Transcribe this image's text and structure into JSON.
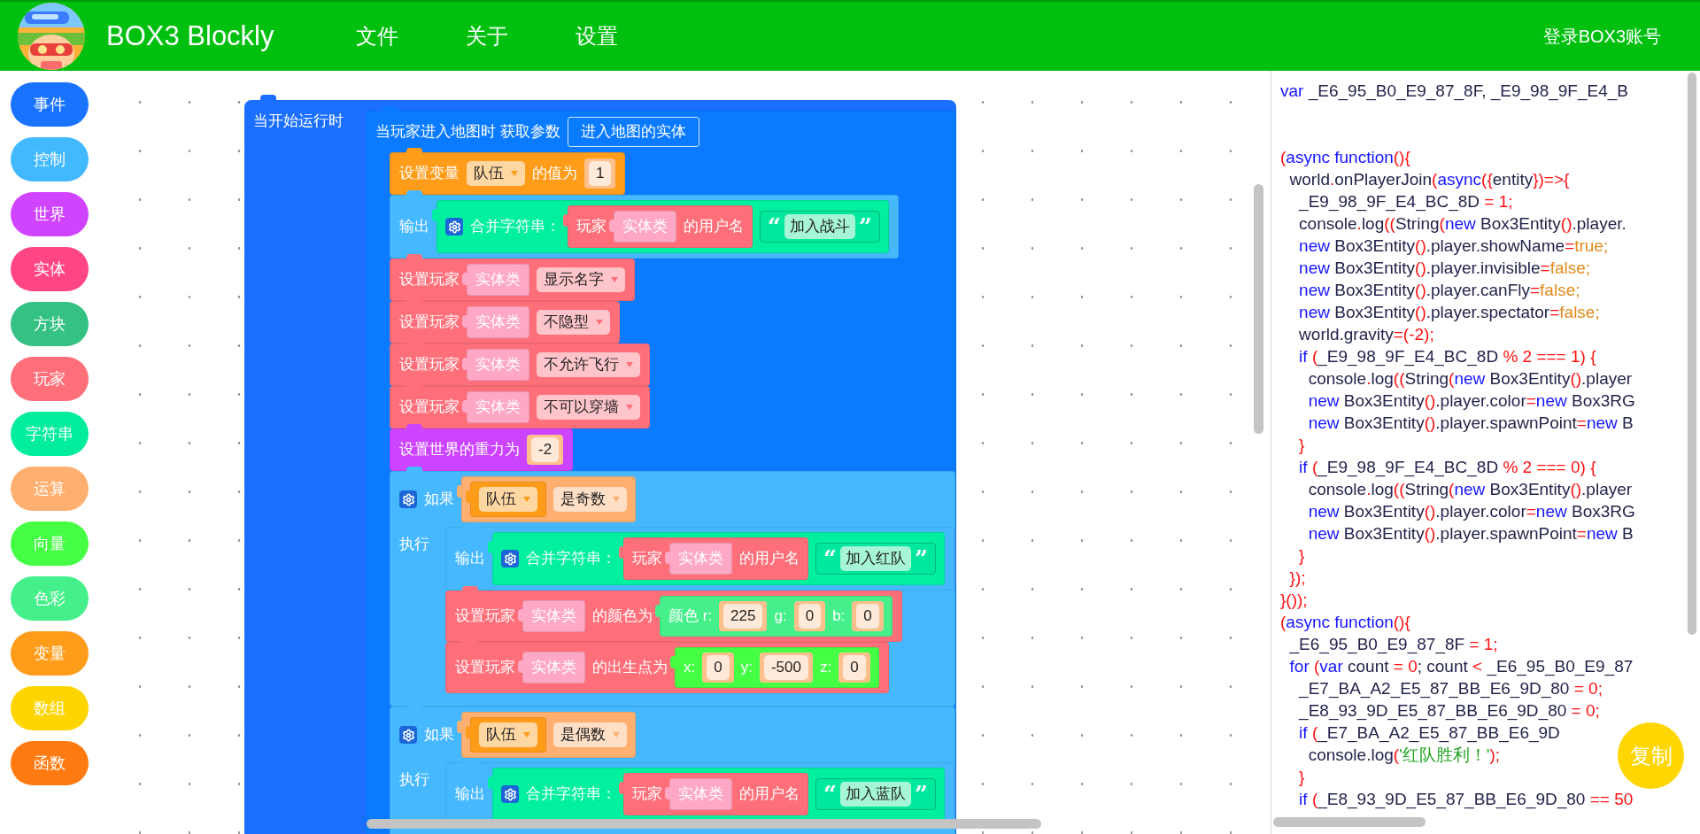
{
  "header": {
    "title": "BOX3 Blockly",
    "menu": [
      "文件",
      "关于",
      "设置"
    ],
    "login": "登录BOX3账号"
  },
  "categories": [
    {
      "label": "事件",
      "color": "#1a73ff"
    },
    {
      "label": "控制",
      "color": "#42b9ff"
    },
    {
      "label": "世界",
      "color": "#d044ff"
    },
    {
      "label": "实体",
      "color": "#ff4585"
    },
    {
      "label": "方块",
      "color": "#36c184"
    },
    {
      "label": "玩家",
      "color": "#ff6f7a"
    },
    {
      "label": "字符串",
      "color": "#00eda0"
    },
    {
      "label": "运算",
      "color": "#ffb070"
    },
    {
      "label": "向量",
      "color": "#44ff44"
    },
    {
      "label": "色彩",
      "color": "#45f08a"
    },
    {
      "label": "变量",
      "color": "#ff9c1a"
    },
    {
      "label": "数组",
      "color": "#ffd500"
    },
    {
      "label": "函数",
      "color": "#ff7a10"
    }
  ],
  "workspace": {
    "blocks": [
      {
        "kind": "hat",
        "color": "#1a6fff",
        "parts": [
          {
            "kind": "text",
            "text": "当开始运行时"
          }
        ],
        "branches": [
          {
            "body": [
              {
                "kind": "statement",
                "color": "#0a7bff",
                "parts": [
                  {
                    "kind": "text",
                    "text": "当玩家进入地图时 获取参数"
                  },
                  {
                    "kind": "param",
                    "text": "进入地图的实体"
                  }
                ],
                "branches": [
                  {
                    "body": [
                      {
                        "kind": "statement",
                        "color": "#ff9c1a",
                        "parts": [
                          {
                            "kind": "text",
                            "text": "设置变量"
                          },
                          {
                            "kind": "dropdown",
                            "text": "队伍"
                          },
                          {
                            "kind": "text",
                            "text": "的值为"
                          },
                          {
                            "kind": "number",
                            "text": "1"
                          }
                        ]
                      },
                      {
                        "kind": "statement",
                        "color": "#45b8ff",
                        "parts": [
                          {
                            "kind": "text",
                            "text": "输出"
                          },
                          {
                            "kind": "block",
                            "color": "#00f0a0",
                            "parts": [
                              {
                                "kind": "gear"
                              },
                              {
                                "kind": "text",
                                "text": "合并字符串："
                              },
                              {
                                "kind": "block",
                                "color": "#ff6f7a",
                                "parts": [
                                  {
                                    "kind": "text",
                                    "text": "玩家"
                                  },
                                  {
                                    "kind": "block",
                                    "color": "#ffa8c5",
                                    "parts": [
                                      {
                                        "kind": "text",
                                        "text": "实体类"
                                      }
                                    ]
                                  },
                                  {
                                    "kind": "text",
                                    "text": "的用户名"
                                  }
                                ]
                              },
                              {
                                "kind": "string",
                                "open": "“",
                                "text": "加入战斗",
                                "close": "”"
                              }
                            ]
                          }
                        ]
                      },
                      {
                        "kind": "statement",
                        "color": "#ff6f7a",
                        "parts": [
                          {
                            "kind": "text",
                            "text": "设置玩家"
                          },
                          {
                            "kind": "block",
                            "color": "#ffa8c5",
                            "parts": [
                              {
                                "kind": "text",
                                "text": "实体类"
                              }
                            ]
                          },
                          {
                            "kind": "dropdown",
                            "text": "显示名字"
                          }
                        ]
                      },
                      {
                        "kind": "statement",
                        "color": "#ff6f7a",
                        "parts": [
                          {
                            "kind": "text",
                            "text": "设置玩家"
                          },
                          {
                            "kind": "block",
                            "color": "#ffa8c5",
                            "parts": [
                              {
                                "kind": "text",
                                "text": "实体类"
                              }
                            ]
                          },
                          {
                            "kind": "dropdown",
                            "text": "不隐型"
                          }
                        ]
                      },
                      {
                        "kind": "statement",
                        "color": "#ff6f7a",
                        "parts": [
                          {
                            "kind": "text",
                            "text": "设置玩家"
                          },
                          {
                            "kind": "block",
                            "color": "#ffa8c5",
                            "parts": [
                              {
                                "kind": "text",
                                "text": "实体类"
                              }
                            ]
                          },
                          {
                            "kind": "dropdown",
                            "text": "不允许飞行"
                          }
                        ]
                      },
                      {
                        "kind": "statement",
                        "color": "#ff6f7a",
                        "parts": [
                          {
                            "kind": "text",
                            "text": "设置玩家"
                          },
                          {
                            "kind": "block",
                            "color": "#ffa8c5",
                            "parts": [
                              {
                                "kind": "text",
                                "text": "实体类"
                              }
                            ]
                          },
                          {
                            "kind": "dropdown",
                            "text": "不可以穿墙"
                          }
                        ]
                      },
                      {
                        "kind": "statement",
                        "color": "#cc44ff",
                        "parts": [
                          {
                            "kind": "text",
                            "text": "设置世界的重力为"
                          },
                          {
                            "kind": "number",
                            "text": "-2"
                          }
                        ]
                      },
                      {
                        "kind": "statement",
                        "color": "#45b8ff",
                        "parts": [
                          {
                            "kind": "gear"
                          },
                          {
                            "kind": "text",
                            "text": "如果"
                          },
                          {
                            "kind": "block",
                            "color": "#ffb070",
                            "parts": [
                              {
                                "kind": "block",
                                "color": "#ff9c1a",
                                "parts": [
                                  {
                                    "kind": "dropdown",
                                    "text": "队伍"
                                  }
                                ]
                              },
                              {
                                "kind": "dropdown",
                                "text": "是奇数"
                              }
                            ]
                          }
                        ],
                        "branches": [
                          {
                            "label": "执行",
                            "body": [
                              {
                                "kind": "statement",
                                "color": "#45b8ff",
                                "parts": [
                                  {
                                    "kind": "text",
                                    "text": "输出"
                                  },
                                  {
                                    "kind": "block",
                                    "color": "#00f0a0",
                                    "parts": [
                                      {
                                        "kind": "gear"
                                      },
                                      {
                                        "kind": "text",
                                        "text": "合并字符串："
                                      },
                                      {
                                        "kind": "block",
                                        "color": "#ff6f7a",
                                        "parts": [
                                          {
                                            "kind": "text",
                                            "text": "玩家"
                                          },
                                          {
                                            "kind": "block",
                                            "color": "#ffa8c5",
                                            "parts": [
                                              {
                                                "kind": "text",
                                                "text": "实体类"
                                              }
                                            ]
                                          },
                                          {
                                            "kind": "text",
                                            "text": "的用户名"
                                          }
                                        ]
                                      },
                                      {
                                        "kind": "string",
                                        "open": "“",
                                        "text": "加入红队",
                                        "close": "”"
                                      }
                                    ]
                                  }
                                ]
                              },
                              {
                                "kind": "statement",
                                "color": "#ff6f7a",
                                "parts": [
                                  {
                                    "kind": "text",
                                    "text": "设置玩家"
                                  },
                                  {
                                    "kind": "block",
                                    "color": "#ffa8c5",
                                    "parts": [
                                      {
                                        "kind": "text",
                                        "text": "实体类"
                                      }
                                    ]
                                  },
                                  {
                                    "kind": "text",
                                    "text": "的颜色为"
                                  },
                                  {
                                    "kind": "block",
                                    "color": "#45f08a",
                                    "parts": [
                                      {
                                        "kind": "text",
                                        "text": "颜色 r:"
                                      },
                                      {
                                        "kind": "number",
                                        "text": "225"
                                      },
                                      {
                                        "kind": "text",
                                        "text": "g:"
                                      },
                                      {
                                        "kind": "number",
                                        "text": "0"
                                      },
                                      {
                                        "kind": "text",
                                        "text": "b:"
                                      },
                                      {
                                        "kind": "number",
                                        "text": "0"
                                      }
                                    ]
                                  }
                                ]
                              },
                              {
                                "kind": "statement",
                                "color": "#ff6f7a",
                                "parts": [
                                  {
                                    "kind": "text",
                                    "text": "设置玩家"
                                  },
                                  {
                                    "kind": "block",
                                    "color": "#ffa8c5",
                                    "parts": [
                                      {
                                        "kind": "text",
                                        "text": "实体类"
                                      }
                                    ]
                                  },
                                  {
                                    "kind": "text",
                                    "text": "的出生点为"
                                  },
                                  {
                                    "kind": "block",
                                    "color": "#44ff44",
                                    "parts": [
                                      {
                                        "kind": "text",
                                        "text": "x:"
                                      },
                                      {
                                        "kind": "number",
                                        "text": "0"
                                      },
                                      {
                                        "kind": "text",
                                        "text": "y:"
                                      },
                                      {
                                        "kind": "number",
                                        "text": "-500"
                                      },
                                      {
                                        "kind": "text",
                                        "text": "z:"
                                      },
                                      {
                                        "kind": "number",
                                        "text": "0"
                                      }
                                    ]
                                  }
                                ]
                              }
                            ]
                          }
                        ]
                      },
                      {
                        "kind": "statement",
                        "color": "#45b8ff",
                        "parts": [
                          {
                            "kind": "gear"
                          },
                          {
                            "kind": "text",
                            "text": "如果"
                          },
                          {
                            "kind": "block",
                            "color": "#ffb070",
                            "parts": [
                              {
                                "kind": "block",
                                "color": "#ff9c1a",
                                "parts": [
                                  {
                                    "kind": "dropdown",
                                    "text": "队伍"
                                  }
                                ]
                              },
                              {
                                "kind": "dropdown",
                                "text": "是偶数"
                              }
                            ]
                          }
                        ],
                        "branches": [
                          {
                            "label": "执行",
                            "body": [
                              {
                                "kind": "statement",
                                "color": "#45b8ff",
                                "parts": [
                                  {
                                    "kind": "text",
                                    "text": "输出"
                                  },
                                  {
                                    "kind": "block",
                                    "color": "#00f0a0",
                                    "parts": [
                                      {
                                        "kind": "gear"
                                      },
                                      {
                                        "kind": "text",
                                        "text": "合并字符串："
                                      },
                                      {
                                        "kind": "block",
                                        "color": "#ff6f7a",
                                        "parts": [
                                          {
                                            "kind": "text",
                                            "text": "玩家"
                                          },
                                          {
                                            "kind": "block",
                                            "color": "#ffa8c5",
                                            "parts": [
                                              {
                                                "kind": "text",
                                                "text": "实体类"
                                              }
                                            ]
                                          },
                                          {
                                            "kind": "text",
                                            "text": "的用户名"
                                          }
                                        ]
                                      },
                                      {
                                        "kind": "string",
                                        "open": "“",
                                        "text": "加入蓝队",
                                        "close": "”"
                                      }
                                    ]
                                  }
                                ]
                              }
                            ]
                          }
                        ]
                      }
                    ]
                  }
                ]
              }
            ]
          }
        ]
      }
    ]
  },
  "code": {
    "sections": [
      {
        "lines": [
          {
            "tokens": [
              {
                "kind": "k",
                "text": "var"
              },
              {
                "kind": "p",
                "text": " _E6_95_B0_E9_87_8F, _E9_98_9F_E4_B"
              }
            ]
          }
        ]
      },
      {
        "lines": [
          {
            "tokens": [
              {
                "kind": "o",
                "text": "("
              },
              {
                "kind": "k",
                "text": "async function"
              },
              {
                "kind": "o",
                "text": "(){"
              }
            ]
          },
          {
            "tokens": [
              {
                "kind": "p",
                "text": "  world"
              },
              {
                "kind": "o",
                "text": "."
              },
              {
                "kind": "p",
                "text": "onPlayerJoin"
              },
              {
                "kind": "o",
                "text": "("
              },
              {
                "kind": "k",
                "text": "async"
              },
              {
                "kind": "o",
                "text": "({"
              },
              {
                "kind": "p",
                "text": "entity"
              },
              {
                "kind": "o",
                "text": "})=>{"
              }
            ]
          },
          {
            "tokens": [
              {
                "kind": "p",
                "text": "    _E9_98_9F_E4_BC_8D "
              },
              {
                "kind": "o",
                "text": "= 1;"
              }
            ]
          },
          {
            "tokens": [
              {
                "kind": "p",
                "text": "    console"
              },
              {
                "kind": "o",
                "text": "."
              },
              {
                "kind": "p",
                "text": "log"
              },
              {
                "kind": "o",
                "text": "(("
              },
              {
                "kind": "p",
                "text": "String"
              },
              {
                "kind": "o",
                "text": "("
              },
              {
                "kind": "k",
                "text": "new"
              },
              {
                "kind": "p",
                "text": " Box3Entity"
              },
              {
                "kind": "o",
                "text": "()"
              },
              {
                "kind": "p",
                "text": ".player."
              }
            ]
          },
          {
            "tokens": [
              {
                "kind": "k",
                "text": "    new"
              },
              {
                "kind": "p",
                "text": " Box3Entity"
              },
              {
                "kind": "o",
                "text": "()"
              },
              {
                "kind": "p",
                "text": ".player.showName"
              },
              {
                "kind": "o",
                "text": "="
              },
              {
                "kind": "l",
                "text": "true;"
              }
            ]
          },
          {
            "tokens": [
              {
                "kind": "k",
                "text": "    new"
              },
              {
                "kind": "p",
                "text": " Box3Entity"
              },
              {
                "kind": "o",
                "text": "()"
              },
              {
                "kind": "p",
                "text": ".player.invisible"
              },
              {
                "kind": "o",
                "text": "="
              },
              {
                "kind": "l",
                "text": "false;"
              }
            ]
          },
          {
            "tokens": [
              {
                "kind": "k",
                "text": "    new"
              },
              {
                "kind": "p",
                "text": " Box3Entity"
              },
              {
                "kind": "o",
                "text": "()"
              },
              {
                "kind": "p",
                "text": ".player.canFly"
              },
              {
                "kind": "o",
                "text": "="
              },
              {
                "kind": "l",
                "text": "false;"
              }
            ]
          },
          {
            "tokens": [
              {
                "kind": "k",
                "text": "    new"
              },
              {
                "kind": "p",
                "text": " Box3Entity"
              },
              {
                "kind": "o",
                "text": "()"
              },
              {
                "kind": "p",
                "text": ".player.spectator"
              },
              {
                "kind": "o",
                "text": "="
              },
              {
                "kind": "l",
                "text": "false;"
              }
            ]
          },
          {
            "tokens": [
              {
                "kind": "p",
                "text": "    world.gravity"
              },
              {
                "kind": "o",
                "text": "=(-2);"
              }
            ]
          },
          {
            "tokens": [
              {
                "kind": "k",
                "text": "    if"
              },
              {
                "kind": "o",
                "text": " ("
              },
              {
                "kind": "p",
                "text": "_E9_98_9F_E4_BC_8D "
              },
              {
                "kind": "o",
                "text": "% 2 === 1) {"
              }
            ]
          },
          {
            "tokens": [
              {
                "kind": "p",
                "text": "      console"
              },
              {
                "kind": "o",
                "text": "."
              },
              {
                "kind": "p",
                "text": "log"
              },
              {
                "kind": "o",
                "text": "(("
              },
              {
                "kind": "p",
                "text": "String"
              },
              {
                "kind": "o",
                "text": "("
              },
              {
                "kind": "k",
                "text": "new"
              },
              {
                "kind": "p",
                "text": " Box3Entity"
              },
              {
                "kind": "o",
                "text": "()"
              },
              {
                "kind": "p",
                "text": ".player"
              }
            ]
          },
          {
            "tokens": [
              {
                "kind": "k",
                "text": "      new"
              },
              {
                "kind": "p",
                "text": " Box3Entity"
              },
              {
                "kind": "o",
                "text": "()"
              },
              {
                "kind": "p",
                "text": ".player.color"
              },
              {
                "kind": "o",
                "text": "="
              },
              {
                "kind": "k",
                "text": "new"
              },
              {
                "kind": "p",
                "text": " Box3RG"
              }
            ]
          },
          {
            "tokens": [
              {
                "kind": "k",
                "text": "      new"
              },
              {
                "kind": "p",
                "text": " Box3Entity"
              },
              {
                "kind": "o",
                "text": "()"
              },
              {
                "kind": "p",
                "text": ".player.spawnPoint"
              },
              {
                "kind": "o",
                "text": "="
              },
              {
                "kind": "k",
                "text": "new"
              },
              {
                "kind": "p",
                "text": " B"
              }
            ]
          },
          {
            "tokens": [
              {
                "kind": "o",
                "text": "    }"
              }
            ]
          },
          {
            "tokens": [
              {
                "kind": "k",
                "text": "    if"
              },
              {
                "kind": "o",
                "text": " ("
              },
              {
                "kind": "p",
                "text": "_E9_98_9F_E4_BC_8D "
              },
              {
                "kind": "o",
                "text": "% 2 === 0) {"
              }
            ]
          },
          {
            "tokens": [
              {
                "kind": "p",
                "text": "      console"
              },
              {
                "kind": "o",
                "text": "."
              },
              {
                "kind": "p",
                "text": "log"
              },
              {
                "kind": "o",
                "text": "(("
              },
              {
                "kind": "p",
                "text": "String"
              },
              {
                "kind": "o",
                "text": "("
              },
              {
                "kind": "k",
                "text": "new"
              },
              {
                "kind": "p",
                "text": " Box3Entity"
              },
              {
                "kind": "o",
                "text": "()"
              },
              {
                "kind": "p",
                "text": ".player"
              }
            ]
          },
          {
            "tokens": [
              {
                "kind": "k",
                "text": "      new"
              },
              {
                "kind": "p",
                "text": " Box3Entity"
              },
              {
                "kind": "o",
                "text": "()"
              },
              {
                "kind": "p",
                "text": ".player.color"
              },
              {
                "kind": "o",
                "text": "="
              },
              {
                "kind": "k",
                "text": "new"
              },
              {
                "kind": "p",
                "text": " Box3RG"
              }
            ]
          },
          {
            "tokens": [
              {
                "kind": "k",
                "text": "      new"
              },
              {
                "kind": "p",
                "text": " Box3Entity"
              },
              {
                "kind": "o",
                "text": "()"
              },
              {
                "kind": "p",
                "text": ".player.spawnPoint"
              },
              {
                "kind": "o",
                "text": "="
              },
              {
                "kind": "k",
                "text": "new"
              },
              {
                "kind": "p",
                "text": " B"
              }
            ]
          },
          {
            "tokens": [
              {
                "kind": "o",
                "text": "    }"
              }
            ]
          },
          {
            "tokens": [
              {
                "kind": "o",
                "text": "  });"
              }
            ]
          },
          {
            "tokens": [
              {
                "kind": "o",
                "text": "}());"
              }
            ]
          },
          {
            "tokens": [
              {
                "kind": "o",
                "text": "("
              },
              {
                "kind": "k",
                "text": "async function"
              },
              {
                "kind": "o",
                "text": "(){"
              }
            ]
          },
          {
            "tokens": [
              {
                "kind": "p",
                "text": "  _E6_95_B0_E9_87_8F "
              },
              {
                "kind": "o",
                "text": "= 1;"
              }
            ]
          },
          {
            "tokens": [
              {
                "kind": "k",
                "text": "  for"
              },
              {
                "kind": "o",
                "text": " ("
              },
              {
                "kind": "k",
                "text": "var"
              },
              {
                "kind": "p",
                "text": " count "
              },
              {
                "kind": "o",
                "text": "= 0"
              },
              {
                "kind": "p",
                "text": "; count "
              },
              {
                "kind": "o",
                "text": "<"
              },
              {
                "kind": "p",
                "text": " _E6_95_B0_E9_87"
              }
            ]
          },
          {
            "tokens": [
              {
                "kind": "p",
                "text": "    _E7_BA_A2_E5_87_BB_E6_9D_80 "
              },
              {
                "kind": "o",
                "text": "= 0;"
              }
            ]
          },
          {
            "tokens": [
              {
                "kind": "p",
                "text": "    _E8_93_9D_E5_87_BB_E6_9D_80 "
              },
              {
                "kind": "o",
                "text": "= 0;"
              }
            ]
          },
          {
            "tokens": [
              {
                "kind": "k",
                "text": "    if"
              },
              {
                "kind": "o",
                "text": " ("
              },
              {
                "kind": "p",
                "text": "_E7_BA_A2_E5_87_BB_E6_9D"
              }
            ]
          },
          {
            "tokens": [
              {
                "kind": "p",
                "text": "      console.log"
              },
              {
                "kind": "o",
                "text": "("
              },
              {
                "kind": "s",
                "text": "'红队胜利！'"
              },
              {
                "kind": "o",
                "text": ");"
              }
            ]
          },
          {
            "tokens": [
              {
                "kind": "o",
                "text": "    }"
              }
            ]
          },
          {
            "tokens": [
              {
                "kind": "k",
                "text": "    if"
              },
              {
                "kind": "o",
                "text": " ("
              },
              {
                "kind": "p",
                "text": "_E8_93_9D_E5_87_BB_E6_9D_80 "
              },
              {
                "kind": "o",
                "text": "== 50"
              }
            ]
          }
        ]
      }
    ],
    "copy_button": "复制"
  }
}
